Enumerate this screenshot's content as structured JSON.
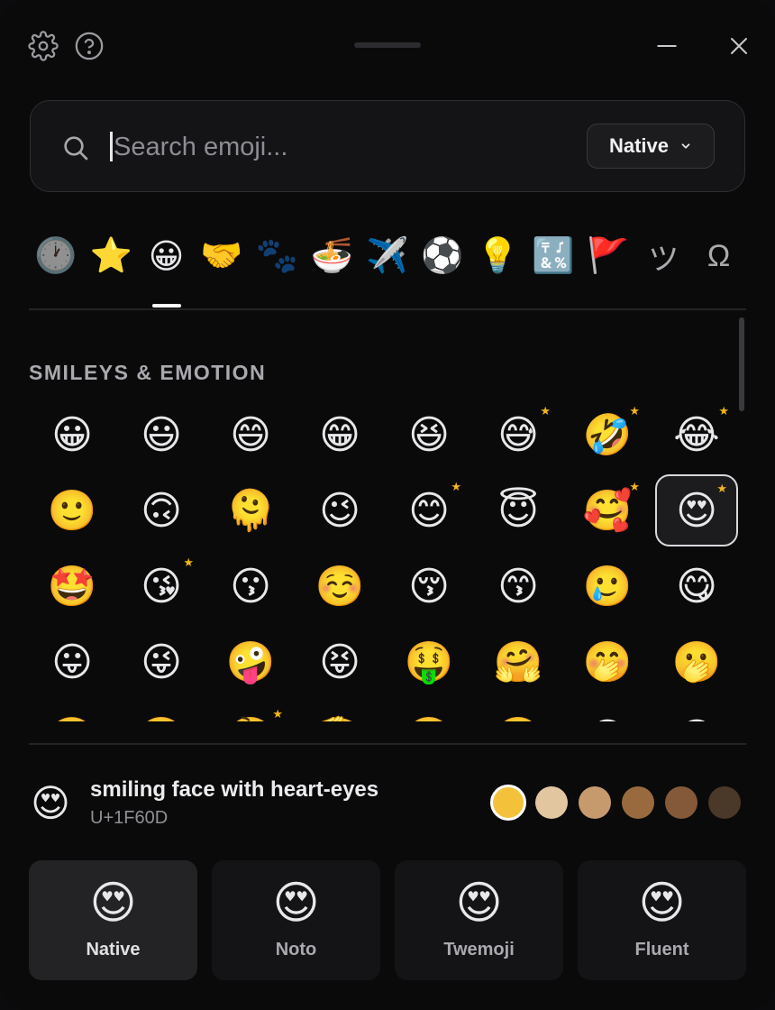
{
  "search": {
    "placeholder": "Search emoji...",
    "value": ""
  },
  "source_select": {
    "value": "Native"
  },
  "categories": [
    {
      "id": "recent",
      "glyph": "🕐",
      "dim": true
    },
    {
      "id": "favorites",
      "glyph": "⭐",
      "dim": false
    },
    {
      "id": "smileys",
      "glyph": "😀",
      "dim": false,
      "active": true
    },
    {
      "id": "people",
      "glyph": "🤝",
      "dim": false
    },
    {
      "id": "animals",
      "glyph": "🐾",
      "dim": true
    },
    {
      "id": "food",
      "glyph": "🍜",
      "dim": false
    },
    {
      "id": "travel",
      "glyph": "✈️",
      "dim": false
    },
    {
      "id": "activities",
      "glyph": "⚽",
      "dim": false
    },
    {
      "id": "objects",
      "glyph": "💡",
      "dim": false
    },
    {
      "id": "symbols",
      "glyph": "🔣",
      "dim": false
    },
    {
      "id": "flags",
      "glyph": "🚩",
      "dim": false
    },
    {
      "id": "kaomoji",
      "glyph": "ツ",
      "dim": false,
      "text": true
    },
    {
      "id": "symbol-letters",
      "glyph": "Ω",
      "dim": false,
      "text": true
    }
  ],
  "section_title": "SMILEYS & EMOTION",
  "emoji_rows": [
    [
      {
        "e": "😀"
      },
      {
        "e": "😃"
      },
      {
        "e": "😄"
      },
      {
        "e": "😁"
      },
      {
        "e": "😆"
      },
      {
        "e": "😅",
        "star": true
      },
      {
        "e": "🤣",
        "star": true
      },
      {
        "e": "😂",
        "star": true
      }
    ],
    [
      {
        "e": "🙂"
      },
      {
        "e": "🙃"
      },
      {
        "e": "🫠"
      },
      {
        "e": "😉"
      },
      {
        "e": "😊",
        "star": true
      },
      {
        "e": "😇"
      },
      {
        "e": "🥰",
        "star": true
      },
      {
        "e": "😍",
        "star": true,
        "selected": true
      }
    ],
    [
      {
        "e": "🤩"
      },
      {
        "e": "😘",
        "star": true
      },
      {
        "e": "😗"
      },
      {
        "e": "☺️"
      },
      {
        "e": "😚"
      },
      {
        "e": "😙"
      },
      {
        "e": "🥲"
      },
      {
        "e": "😋"
      }
    ],
    [
      {
        "e": "😛"
      },
      {
        "e": "😜"
      },
      {
        "e": "🤪"
      },
      {
        "e": "😝"
      },
      {
        "e": "🤑"
      },
      {
        "e": "🤗"
      },
      {
        "e": "🤭"
      },
      {
        "e": "🫢"
      }
    ],
    [
      {
        "e": "🫣"
      },
      {
        "e": "🤫"
      },
      {
        "e": "🤔",
        "star": true
      },
      {
        "e": "🫡"
      },
      {
        "e": "🤐"
      },
      {
        "e": "🤨"
      },
      {
        "e": "😐"
      },
      {
        "e": "😑"
      }
    ]
  ],
  "preview": {
    "emoji": "😍",
    "name": "smiling face with heart-eyes",
    "code": "U+1F60D"
  },
  "skin_tones": [
    "#f4c23a",
    "#e2c6a0",
    "#c79a6e",
    "#9a6a3f",
    "#84593a",
    "#4a3828"
  ],
  "styles": [
    {
      "label": "Native",
      "glyph": "😍",
      "active": true
    },
    {
      "label": "Noto",
      "glyph": "😍",
      "active": false
    },
    {
      "label": "Twemoji",
      "glyph": "😍",
      "active": false
    },
    {
      "label": "Fluent",
      "glyph": "😍",
      "active": false
    }
  ]
}
